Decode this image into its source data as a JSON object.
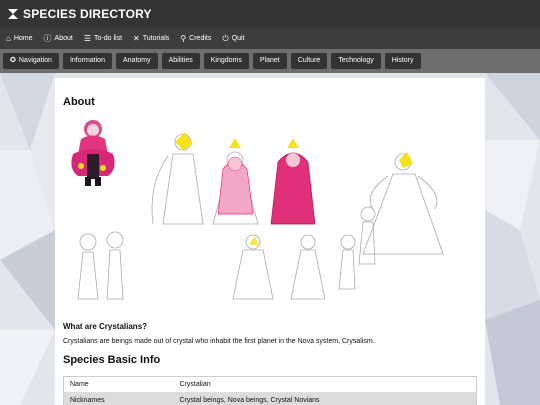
{
  "app": {
    "title": "SPECIES DIRECTORY"
  },
  "nav": {
    "items": [
      {
        "icon": "home-icon",
        "label": "Home"
      },
      {
        "icon": "info-icon",
        "label": "About"
      },
      {
        "icon": "list-icon",
        "label": "To-do list"
      },
      {
        "icon": "tools-icon",
        "label": "Tutorials"
      },
      {
        "icon": "search-icon",
        "label": "Credits"
      },
      {
        "icon": "power-icon",
        "label": "Quit"
      }
    ]
  },
  "tabs": {
    "items": [
      {
        "label": "Navigation",
        "icon": "compass-icon"
      },
      {
        "label": "Information"
      },
      {
        "label": "Anatomy"
      },
      {
        "label": "Abilities"
      },
      {
        "label": "Kingdoms"
      },
      {
        "label": "Planet"
      },
      {
        "label": "Culture"
      },
      {
        "label": "Technology"
      },
      {
        "label": "History"
      }
    ]
  },
  "main": {
    "about_heading": "About",
    "what_heading": "What are Crystalians?",
    "what_text": "Crystalians are beings made out of crystal who inhabit the first planet in the Nova system, Crysalism.",
    "basic_heading": "Species Basic Info",
    "basic_rows": [
      {
        "key": "Name",
        "value": "Crystalian"
      },
      {
        "key": "Nicknames",
        "value": "Crystal beings, Nova beings, Crystal Novians"
      }
    ]
  },
  "colors": {
    "topbar": "#343434",
    "navbar": "#3d3d3d",
    "tabbar": "#6e6e6e",
    "tab": "#333333",
    "accent_pink": "#e0307a",
    "accent_yellow": "#f5e21a"
  }
}
